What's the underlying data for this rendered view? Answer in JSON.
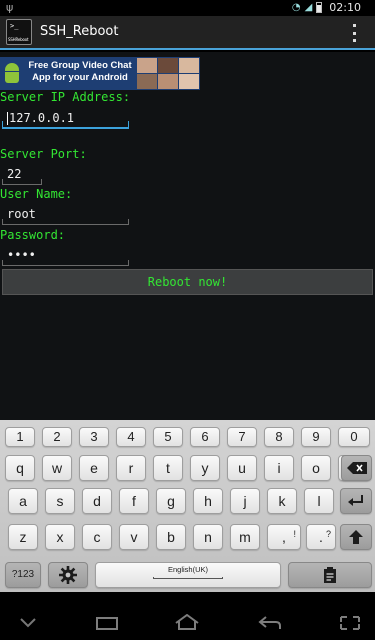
{
  "status_bar": {
    "time": "02:10",
    "icons": [
      "usb-icon",
      "wifi-icon",
      "signal-icon",
      "battery-icon"
    ]
  },
  "action_bar": {
    "app_icon_prompt": ">_",
    "app_icon_text": "SSHReboot",
    "title": "SSH_Reboot",
    "overflow_icon": "overflow-menu-icon"
  },
  "ad_banner": {
    "line1": "Free Group Video Chat",
    "line2": "App for your Android"
  },
  "form": {
    "server_ip_label": "Server IP Address:",
    "server_ip_value": "127.0.0.1",
    "server_port_label": "Server Port:",
    "server_port_value": "22",
    "user_name_label": "User Name:",
    "user_name_value": "root",
    "password_label": "Password:",
    "password_value": "••••",
    "reboot_button": "Reboot now!"
  },
  "colors": {
    "label_green": "#33e633",
    "focus_blue": "#3ca2dc",
    "action_bar_line": "#4aa3d8"
  },
  "keyboard": {
    "row_numbers": [
      "1",
      "2",
      "3",
      "4",
      "5",
      "6",
      "7",
      "8",
      "9",
      "0"
    ],
    "row_top": [
      "q",
      "w",
      "e",
      "r",
      "t",
      "y",
      "u",
      "i",
      "o",
      "p"
    ],
    "row_middle": [
      "a",
      "s",
      "d",
      "f",
      "g",
      "h",
      "j",
      "k",
      "l"
    ],
    "row_bottom": [
      "z",
      "x",
      "c",
      "v",
      "b",
      "n",
      "m"
    ],
    "comma_key": ",",
    "comma_sub": "!",
    "period_key": ".",
    "period_sub": "?",
    "symbols_key": "?123",
    "space_label": "English(UK)",
    "icons": [
      "backspace-icon",
      "enter-icon",
      "shift-icon",
      "settings-icon",
      "clipboard-icon"
    ]
  },
  "nav_bar": {
    "icons": [
      "back-icon",
      "home-icon",
      "recent-apps-icon",
      "screenshot-icon"
    ]
  }
}
